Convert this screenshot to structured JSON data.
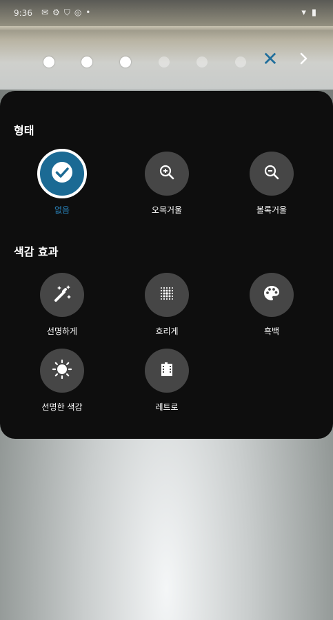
{
  "status_bar": {
    "time": "9:36",
    "icons": [
      "message-icon",
      "settings-icon",
      "shield-icon",
      "sd-icon",
      "dot-icon"
    ],
    "right_icons": [
      "wifi-icon",
      "battery-icon"
    ]
  },
  "page_indicator": {
    "total": 6,
    "active_count": 3
  },
  "colors": {
    "accent": "#1f6e9c",
    "selected_fill": "#1b6a94",
    "panel": "#0e0e0e",
    "button": "#464646"
  },
  "sections": {
    "shape": {
      "title": "형태",
      "options": [
        {
          "label": "없음",
          "icon": "check-icon",
          "selected": true
        },
        {
          "label": "오목거울",
          "icon": "zoom-in-icon",
          "selected": false
        },
        {
          "label": "볼록거울",
          "icon": "zoom-out-icon",
          "selected": false
        }
      ]
    },
    "color_effect": {
      "title": "색감 효과",
      "options": [
        {
          "label": "선명하게",
          "icon": "magic-wand-icon"
        },
        {
          "label": "흐리게",
          "icon": "blur-grid-icon"
        },
        {
          "label": "흑백",
          "icon": "palette-icon"
        },
        {
          "label": "선명한 색감",
          "icon": "brightness-icon"
        },
        {
          "label": "레트로",
          "icon": "film-icon"
        }
      ]
    }
  }
}
